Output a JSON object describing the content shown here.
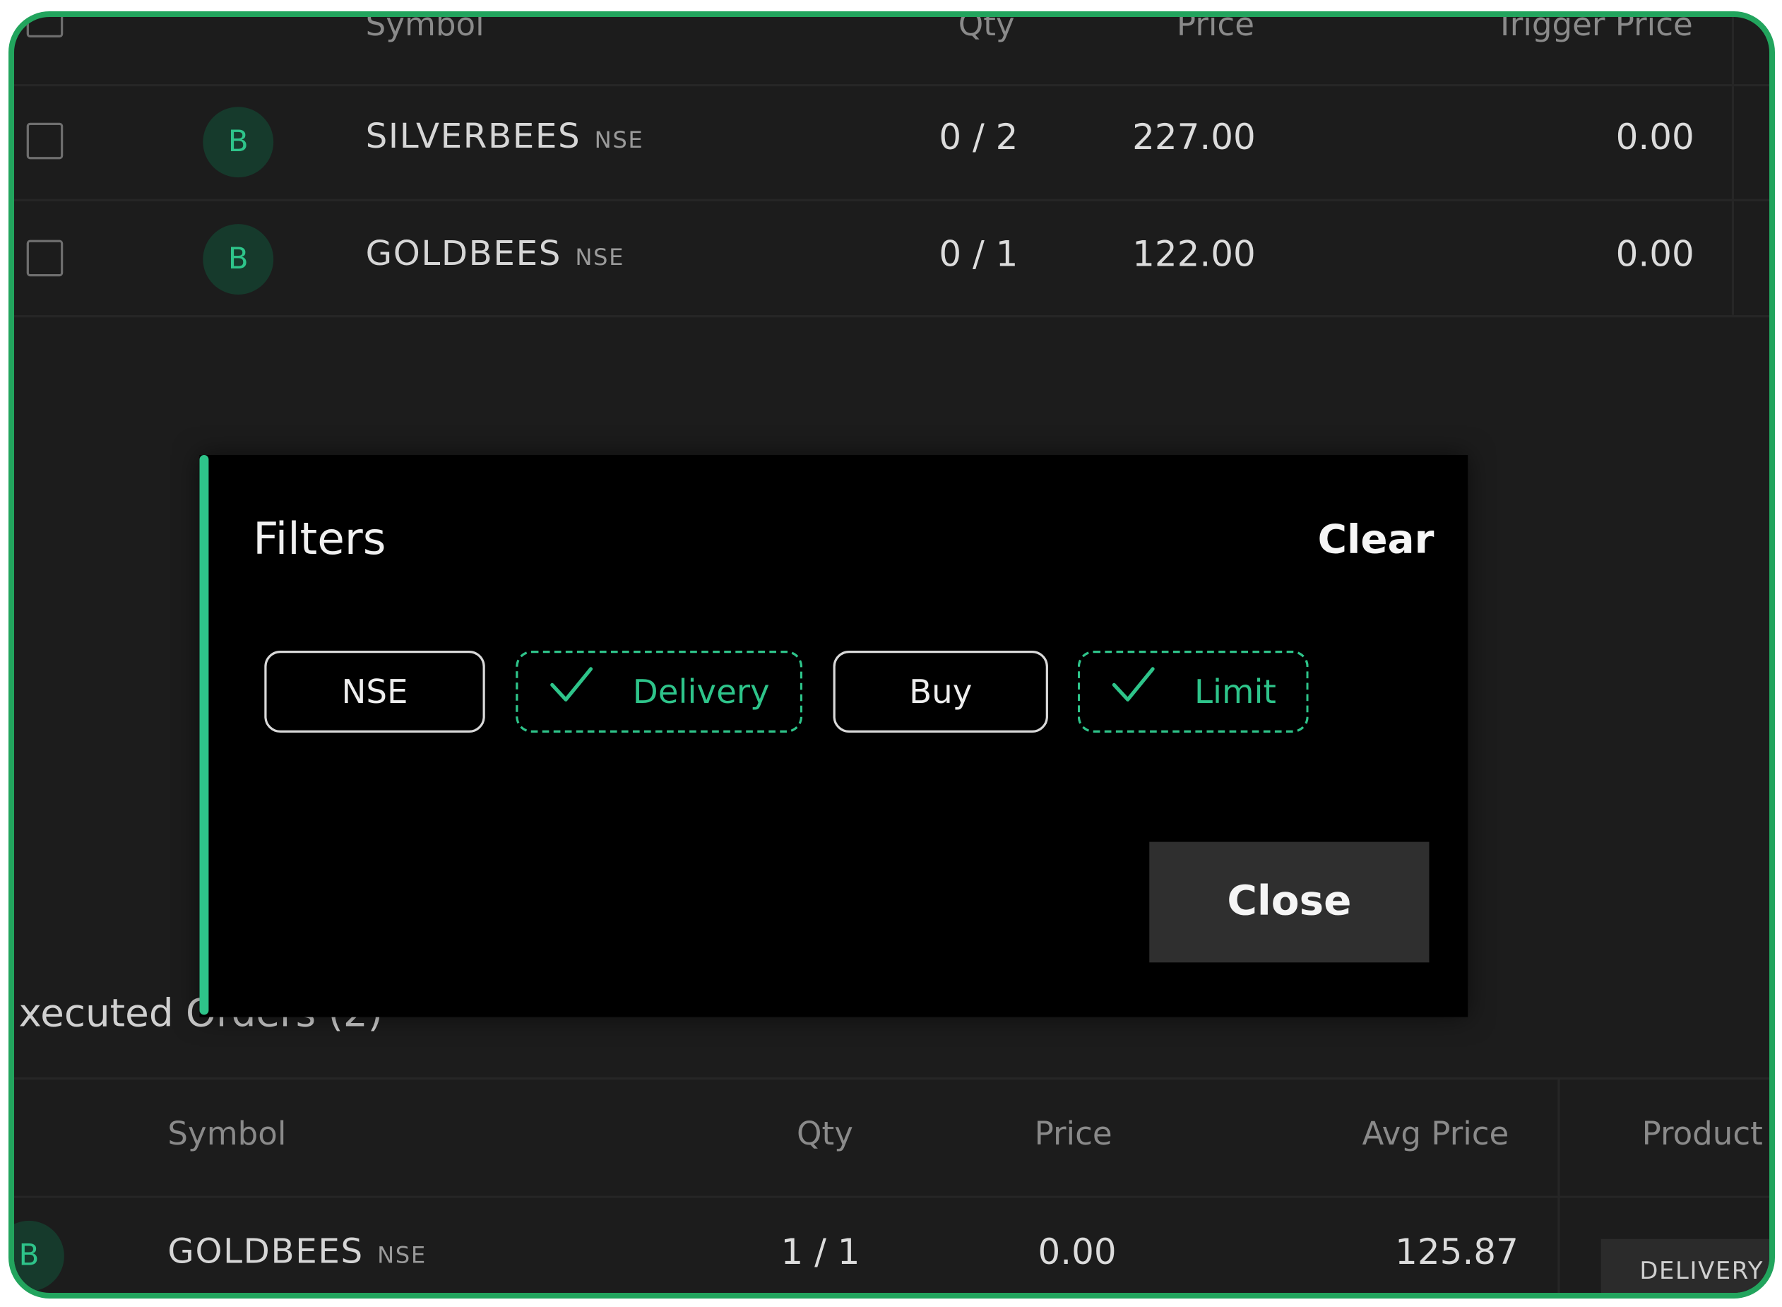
{
  "pending_orders": {
    "headers": {
      "symbol": "Symbol",
      "qty": "Qty",
      "price": "Price",
      "trigger_price": "Trigger Price"
    },
    "rows": [
      {
        "side": "B",
        "symbol": "SILVERBEES",
        "exchange": "NSE",
        "qty": "0 / 2",
        "price": "227.00",
        "trigger_price": "0.00"
      },
      {
        "side": "B",
        "symbol": "GOLDBEES",
        "exchange": "NSE",
        "qty": "0 / 1",
        "price": "122.00",
        "trigger_price": "0.00"
      }
    ]
  },
  "executed_orders": {
    "title": "xecuted Orders (2)",
    "headers": {
      "symbol": "Symbol",
      "qty": "Qty",
      "price": "Price",
      "avg_price": "Avg Price",
      "product": "Product"
    },
    "rows": [
      {
        "side": "B",
        "symbol": "GOLDBEES",
        "exchange": "NSE",
        "qty": "1 / 1",
        "price": "0.00",
        "avg_price": "125.87",
        "product": "DELIVERY"
      }
    ]
  },
  "filters_modal": {
    "title": "Filters",
    "clear_label": "Clear",
    "chips": [
      {
        "label": "NSE",
        "selected": false
      },
      {
        "label": "Delivery",
        "selected": true
      },
      {
        "label": "Buy",
        "selected": false
      },
      {
        "label": "Limit",
        "selected": true
      }
    ],
    "close_label": "Close"
  },
  "colors": {
    "accent": "#2ec48a",
    "background": "#1c1c1c",
    "modal_background": "#000000",
    "frame_border": "#22a45d"
  },
  "icons": {
    "chip_check": "check-icon"
  }
}
